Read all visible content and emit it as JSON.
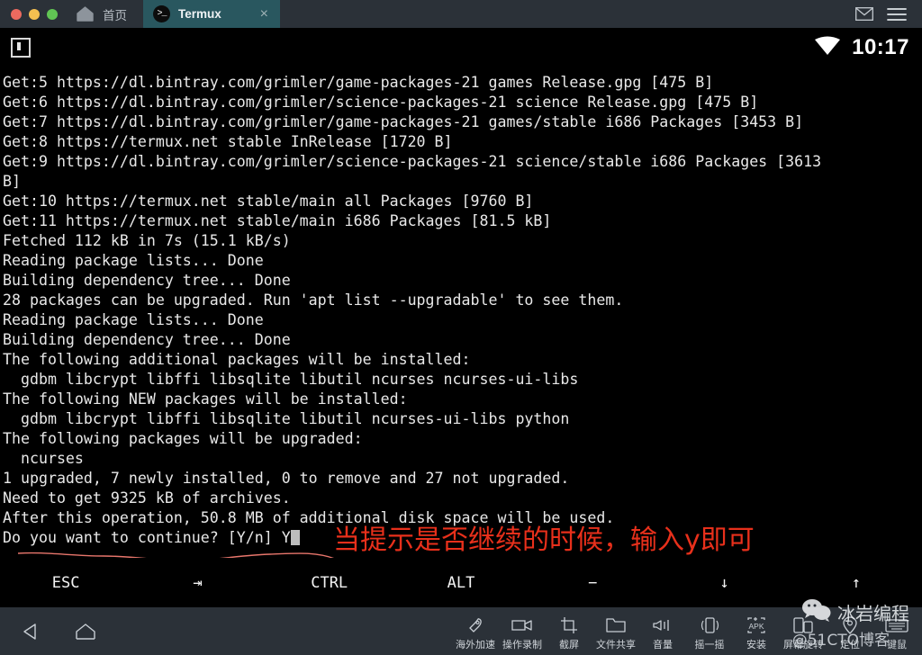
{
  "titlebar": {
    "window_controls": [
      "close",
      "minimize",
      "maximize"
    ],
    "home_tab_label": "首页",
    "home_icon": "home-icon",
    "terminal_tab": {
      "label": "Termux",
      "icon": "terminal-prompt-icon",
      "close_label": "×",
      "accent_color": "#29575f"
    },
    "mail_icon": "envelope-icon",
    "menu_icon": "hamburger-menu-icon",
    "background_color": "#2b3138"
  },
  "statusbar": {
    "session_icon": "session-cursor-icon",
    "wifi_icon": "wifi-icon",
    "clock": "10:17"
  },
  "terminal": {
    "lines": [
      "Get:5 https://dl.bintray.com/grimler/game-packages-21 games Release.gpg [475 B]",
      "Get:6 https://dl.bintray.com/grimler/science-packages-21 science Release.gpg [475 B]",
      "Get:7 https://dl.bintray.com/grimler/game-packages-21 games/stable i686 Packages [3453 B]",
      "Get:8 https://termux.net stable InRelease [1720 B]",
      "Get:9 https://dl.bintray.com/grimler/science-packages-21 science/stable i686 Packages [3613",
      "B]",
      "Get:10 https://termux.net stable/main all Packages [9760 B]",
      "Get:11 https://termux.net stable/main i686 Packages [81.5 kB]",
      "Fetched 112 kB in 7s (15.1 kB/s)",
      "Reading package lists... Done",
      "Building dependency tree... Done",
      "28 packages can be upgraded. Run 'apt list --upgradable' to see them.",
      "Reading package lists... Done",
      "Building dependency tree... Done",
      "The following additional packages will be installed:",
      "  gdbm libcrypt libffi libsqlite libutil ncurses ncurses-ui-libs",
      "The following NEW packages will be installed:",
      "  gdbm libcrypt libffi libsqlite libutil ncurses-ui-libs python",
      "The following packages will be upgraded:",
      "  ncurses",
      "1 upgraded, 7 newly installed, 0 to remove and 27 not upgraded.",
      "Need to get 9325 kB of archives.",
      "After this operation, 50.8 MB of additional disk space will be used."
    ],
    "prompt_line": "Do you want to continue? [Y/n] Y",
    "text_color": "#e8e8e8",
    "background_color": "#000000"
  },
  "annotation": {
    "text": "当提示是否继续的时候，输入y即可",
    "color": "#e8301b",
    "underline_color": "#e8766c"
  },
  "extra_keys": [
    {
      "label": "ESC",
      "name": "esc-key"
    },
    {
      "label": "⇥",
      "name": "tab-key"
    },
    {
      "label": "CTRL",
      "name": "ctrl-key"
    },
    {
      "label": "ALT",
      "name": "alt-key"
    },
    {
      "label": "−",
      "name": "minus-key"
    },
    {
      "label": "↓",
      "name": "arrow-down-key"
    },
    {
      "label": "↑",
      "name": "arrow-up-key"
    }
  ],
  "navbar": {
    "system_buttons": [
      {
        "name": "back-button",
        "icon": "triangle-back-icon"
      },
      {
        "name": "home-button",
        "icon": "home-outline-icon"
      }
    ],
    "tools": [
      {
        "label": "海外加速",
        "icon": "rocket-icon",
        "name": "tool-overseas-accelerate"
      },
      {
        "label": "操作录制",
        "icon": "video-camera-icon",
        "name": "tool-record"
      },
      {
        "label": "截屏",
        "icon": "crop-screenshot-icon",
        "name": "tool-screenshot"
      },
      {
        "label": "文件共享",
        "icon": "folder-icon",
        "name": "tool-file-share"
      },
      {
        "label": "音量",
        "icon": "speaker-icon",
        "name": "tool-volume"
      },
      {
        "label": "摇一摇",
        "icon": "shake-phone-icon",
        "name": "tool-shake"
      },
      {
        "label": "安装",
        "icon": "apk-install-icon",
        "name": "tool-install"
      },
      {
        "label": "屏幕旋转",
        "icon": "rotate-screen-icon",
        "name": "tool-rotate"
      },
      {
        "label": "定位",
        "icon": "location-pin-icon",
        "name": "tool-location"
      },
      {
        "label": "键鼠",
        "icon": "keyboard-icon",
        "name": "tool-keyboard-mouse"
      }
    ],
    "background_color": "#2b3138"
  },
  "watermark": {
    "title": "冰岩编程",
    "subtitle": "@51CTO博客",
    "icon": "wechat-icon"
  }
}
